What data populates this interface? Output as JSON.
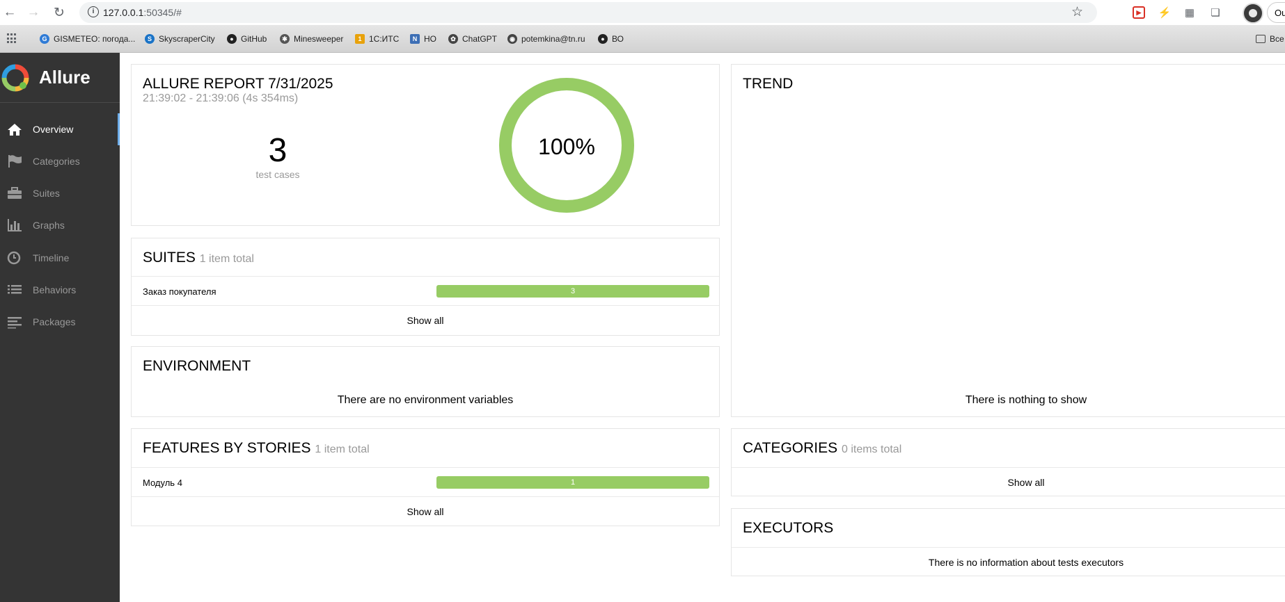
{
  "browser": {
    "url_host": "127.0.0.1",
    "url_path": ":50345/#",
    "profile_label": "Ou"
  },
  "bookmarks": [
    {
      "label": "GISMETEO: погода...",
      "icon": "gismeteo-icon",
      "color": "#2f7bd6"
    },
    {
      "label": "SkyscraperCity",
      "icon": "skyscrapercity-icon",
      "color": "#1a73c7"
    },
    {
      "label": "GitHub",
      "icon": "github-icon",
      "color": "#222222"
    },
    {
      "label": "Minesweeper",
      "icon": "minesweeper-icon",
      "color": "#555555"
    },
    {
      "label": "1С:ИТС",
      "icon": "1c-its-icon",
      "color": "#e8a20c"
    },
    {
      "label": "НО",
      "icon": "no-icon",
      "color": "#3d6fb5"
    },
    {
      "label": "ChatGPT",
      "icon": "chatgpt-icon",
      "color": "#444444"
    },
    {
      "label": "potemkina@tn.ru",
      "icon": "globe-icon",
      "color": "#444444"
    },
    {
      "label": "ВО",
      "icon": "github-icon",
      "color": "#222222"
    }
  ],
  "bookmarks_folder": "Все",
  "allure": {
    "brand": "Allure",
    "nav": [
      {
        "label": "Overview",
        "icon": "home-icon",
        "active": true
      },
      {
        "label": "Categories",
        "icon": "flag-icon",
        "active": false
      },
      {
        "label": "Suites",
        "icon": "briefcase-icon",
        "active": false
      },
      {
        "label": "Graphs",
        "icon": "bar-chart-icon",
        "active": false
      },
      {
        "label": "Timeline",
        "icon": "clock-icon",
        "active": false
      },
      {
        "label": "Behaviors",
        "icon": "list-icon",
        "active": false
      },
      {
        "label": "Packages",
        "icon": "align-left-icon",
        "active": false
      }
    ],
    "summary": {
      "title": "ALLURE REPORT 7/31/2025",
      "time_range": "21:39:02 - 21:39:06 (4s 354ms)",
      "test_count": "3",
      "test_count_label": "test cases",
      "pass_percent": "100%",
      "pass_ratio": 1.0,
      "ring_color": "#97cc64"
    },
    "suites": {
      "title": "SUITES",
      "count": "1 item total",
      "rows": [
        {
          "name": "Заказ покупателя",
          "passed": "3",
          "fraction": 1.0
        }
      ],
      "show_all": "Show all"
    },
    "environment": {
      "title": "ENVIRONMENT",
      "message": "There are no environment variables"
    },
    "features": {
      "title": "FEATURES BY STORIES",
      "count": "1 item total",
      "rows": [
        {
          "name": "Модуль 4",
          "passed": "1",
          "fraction": 1.0
        }
      ],
      "show_all": "Show all"
    },
    "trend": {
      "title": "TREND",
      "message": "There is nothing to show"
    },
    "categories": {
      "title": "CATEGORIES",
      "count": "0 items total",
      "show_all": "Show all"
    },
    "executors": {
      "title": "EXECUTORS",
      "message": "There is no information about tests executors"
    }
  }
}
